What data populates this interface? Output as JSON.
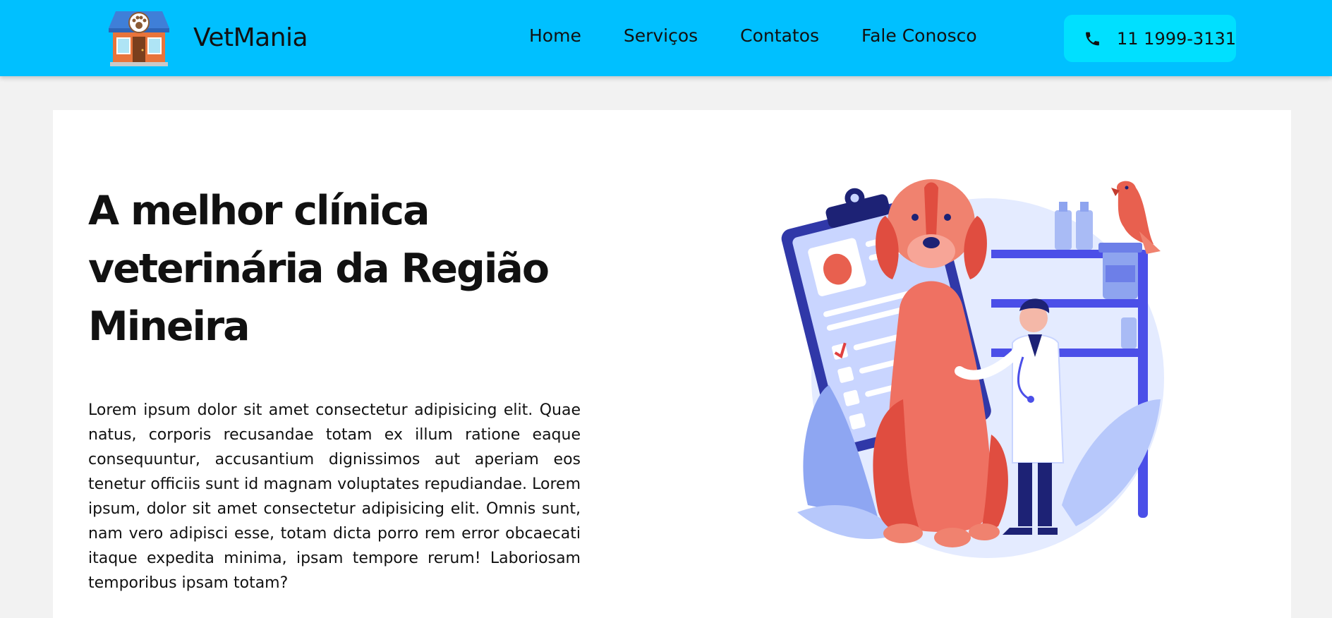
{
  "header": {
    "brand": "VetMania",
    "nav": [
      "Home",
      "Serviços",
      "Contatos",
      "Fale Conosco"
    ],
    "phone": "11 1999-3131",
    "logo_icon": "pet-shop-storefront-icon",
    "phone_icon": "phone-icon"
  },
  "hero": {
    "title": "A melhor clínica veterinária da Região Mineira",
    "text": "Lorem ipsum dolor sit amet consectetur adipisicing elit. Quae natus, corporis recusandae totam ex illum ratione eaque consequuntur, accusantium dignissimos aut aperiam eos tenetur officiis sunt id magnam voluptates repudiandae. Lorem ipsum, dolor sit amet consectetur adipisicing elit. Omnis sunt, nam vero adipisci esse, totam dicta porro rem error obcaecati itaque expedita minima, ipsam tempore rerum! Laboriosam temporibus ipsam totam?",
    "illustration": "veterinarian-with-dog-illustration"
  },
  "colors": {
    "navbar": "#00c0ff",
    "phone_button": "#00e0ff",
    "page_background": "#f2f2f2",
    "card": "#ffffff"
  }
}
